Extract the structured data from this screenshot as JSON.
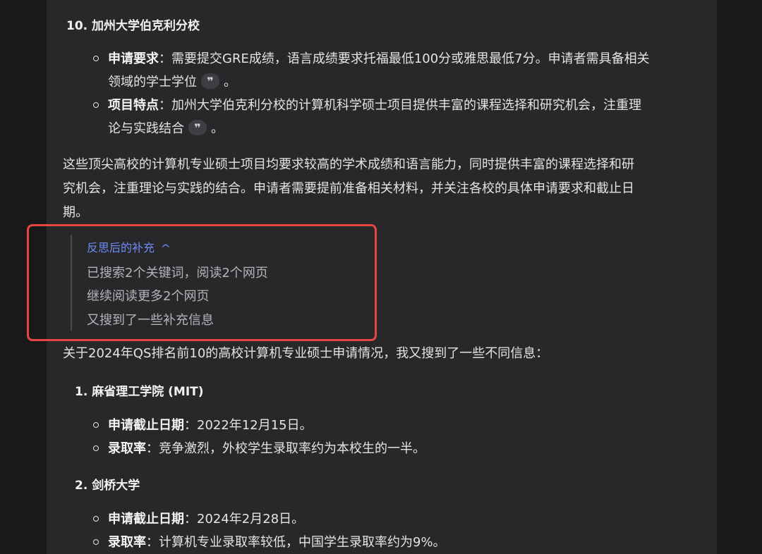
{
  "colors": {
    "background": "#19191b",
    "panel": "#28282b",
    "text": "#e4e4e6",
    "accent": "#6e8cf5",
    "highlight_box": "#e5463f"
  },
  "section1": {
    "number": "10.",
    "title": "加州大学伯克利分校",
    "items": [
      {
        "label": "申请要求",
        "line1": "：需要提交GRE成绩，语言成绩要求托福最低100分或雅思最低7分。申请者需具备相关",
        "line2": "领域的学士学位",
        "suffix": "。"
      },
      {
        "label": "项目特点",
        "line1": "：加州大学伯克利分校的计算机科学硕士项目提供丰富的课程选择和研究机会，注重理",
        "line2": "论与实践结合",
        "suffix": "。"
      }
    ]
  },
  "quote_icon": "quote-icon",
  "quote_glyph": "❞",
  "summary": {
    "line1": "这些顶尖高校的计算机专业硕士项目均要求较高的学术成绩和语言能力，同时提供丰富的课程选择和研",
    "line2": "究机会，注重理论与实践的结合。申请者需要提前准备相关材料，并关注各校的具体申请要求和截止日",
    "line3": "期。"
  },
  "reflection": {
    "title": "反思后的补充",
    "chevron_icon": "chevron-up-icon",
    "chevron_glyph": "^",
    "steps": [
      "已搜索2个关键词，阅读2个网页",
      "继续阅读更多2个网页",
      "又搜到了一些补充信息"
    ]
  },
  "intro": "关于2024年QS排名前10的高校计算机专业硕士申请情况，我又搜到了一些不同信息：",
  "schools": [
    {
      "number": "1.",
      "name": "麻省理工学院 (MIT)",
      "items": [
        {
          "label": "申请截止日期",
          "text": "：2022年12月15日。"
        },
        {
          "label": "录取率",
          "text": "：竞争激烈，外校学生录取率约为本校生的一半。"
        }
      ]
    },
    {
      "number": "2.",
      "name": "剑桥大学",
      "items": [
        {
          "label": "申请截止日期",
          "text": "：2024年2月28日。"
        },
        {
          "label": "录取率",
          "text": "：计算机专业录取率较低，中国学生录取率约为9%。"
        }
      ]
    }
  ]
}
